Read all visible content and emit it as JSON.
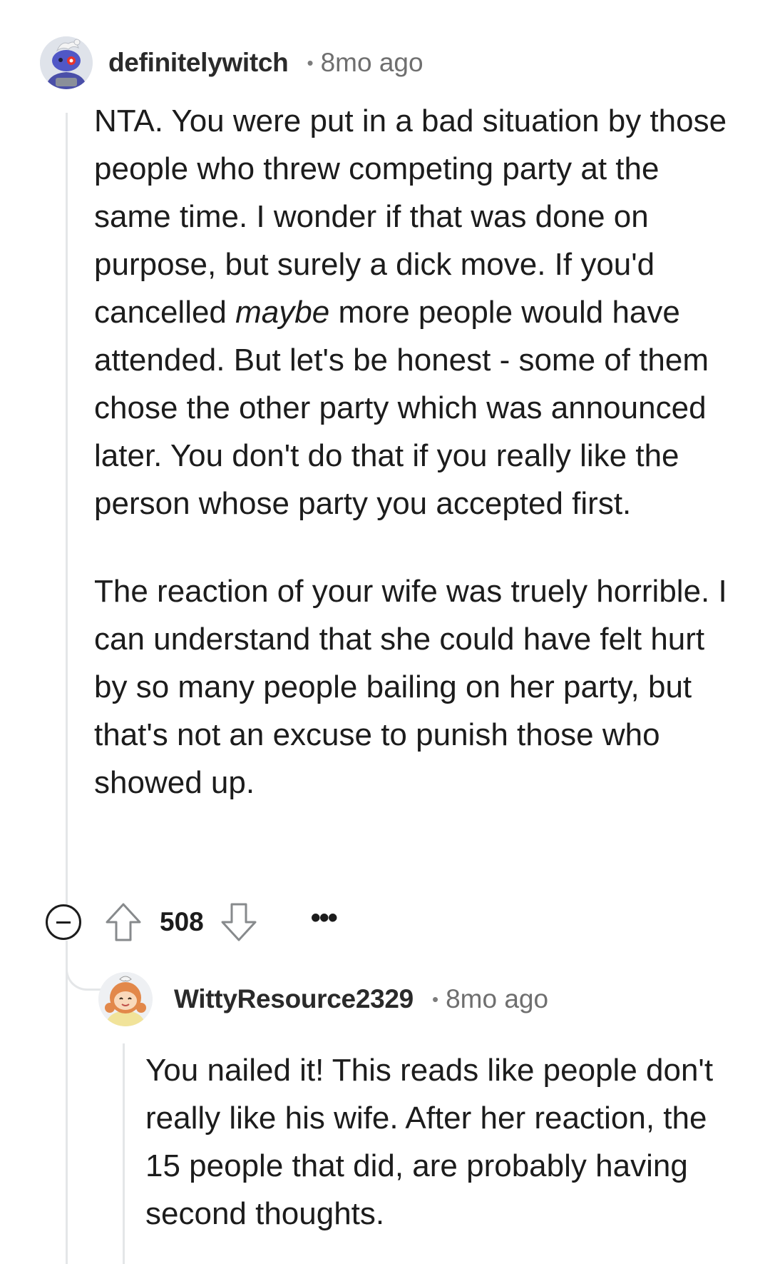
{
  "comment": {
    "author": "definitelywitch",
    "separator": "•",
    "time": "8mo ago",
    "body_p1_a": "NTA. You were put in a bad situation by those people who threw competing party at the same time. I wonder if that was done on purpose, but surely a dick move. If you'd cancelled ",
    "body_p1_em": "maybe",
    "body_p1_b": " more people would have attended. But let's be honest - some of them chose the other party which was announced later. You don't do that if you really like the person whose party you accepted first.",
    "body_p2": "The reaction of your wife was truely horrible. I can understand that she could have felt hurt by so many people bailing on her party, but that's not an excuse to punish those who showed up.",
    "score": "508",
    "more": "•••"
  },
  "reply": {
    "author": "WittyResource2329",
    "separator": "•",
    "time": "8mo ago",
    "body": "You nailed it! This reads like people don't really like his wife. After her reaction, the 15 people that did, are probably having second thoughts."
  },
  "colors": {
    "thread_line": "#e4e6e8",
    "text": "#1c1c1c",
    "meta": "#6f6f6f",
    "vote_outline": "#878a8c"
  },
  "icons": {
    "collapse": "collapse-icon",
    "upvote": "upvote-icon",
    "downvote": "downvote-icon",
    "more": "more-options-icon"
  }
}
